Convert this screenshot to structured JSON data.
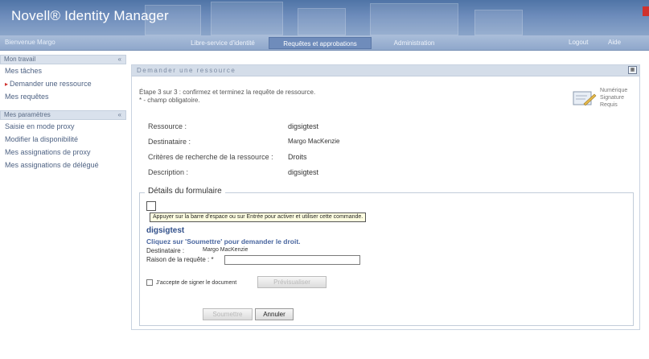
{
  "header": {
    "app_title": "Novell® Identity Manager"
  },
  "navbar": {
    "welcome": "Bienvenue Margo",
    "tabs": [
      "Libre-service d'identité",
      "Requêtes et approbations",
      "Administration"
    ],
    "logout": "Logout",
    "help": "Aide"
  },
  "sidebar": {
    "section1_title": "Mon travail",
    "section1_items": [
      "Mes tâches",
      "Demander une ressource",
      "Mes requêtes"
    ],
    "section2_title": "Mes paramètres",
    "section2_items": [
      "Saisie en mode proxy",
      "Modifier la disponibilité",
      "Mes assignations de proxy",
      "Mes assignations de délégué"
    ],
    "collapse_glyph": "«"
  },
  "panel": {
    "title": "Demander une ressource",
    "step_text": "Étape 3 sur 3 : confirmez et terminez la requête de ressource.",
    "required_text": "* - champ obligatoire.",
    "signature_lines": [
      "Numérique",
      "Signature",
      "Requis"
    ],
    "info": [
      {
        "label": "Ressource :",
        "value": "digsigtest"
      },
      {
        "label": "Destinataire :",
        "value": "Margo MacKenzie"
      },
      {
        "label": "Critères de recherche de la ressource :",
        "value": "Droits"
      },
      {
        "label": "Description :",
        "value": "digsigtest"
      }
    ]
  },
  "form": {
    "legend": "Détails du formulaire",
    "tooltip": "Appuyer sur la barre d'espace ou sur Entrée pour activer et utiliser cette commande.",
    "resource_name": "digsigtest",
    "instruction": "Cliquez sur 'Soumettre' pour demander le droit.",
    "dest_label": "Destinataire :",
    "dest_value": "Margo MacKenzie",
    "reason_label": "Raison de la requête : *",
    "reason_value": "",
    "accept_label": "J'accepte de signer le document",
    "preview_button": "Prévisualiser",
    "submit_button": "Soumettre",
    "cancel_button": "Annuler"
  }
}
